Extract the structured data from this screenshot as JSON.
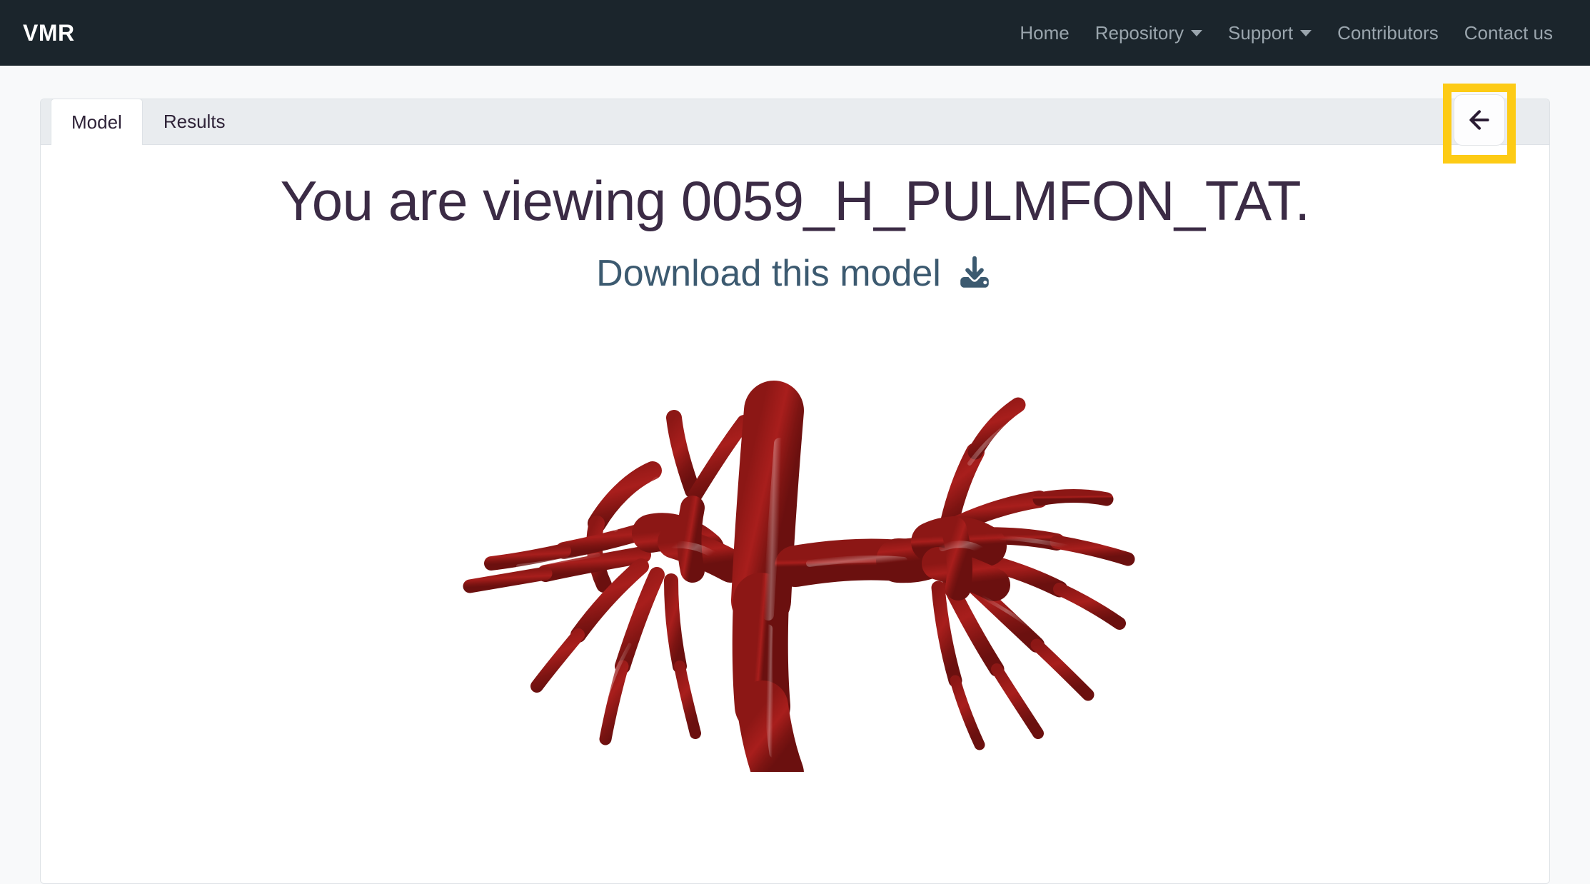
{
  "navbar": {
    "brand": "VMR",
    "items": [
      {
        "label": "Home",
        "has_caret": false
      },
      {
        "label": "Repository",
        "has_caret": true
      },
      {
        "label": "Support",
        "has_caret": true
      },
      {
        "label": "Contributors",
        "has_caret": false
      },
      {
        "label": "Contact us",
        "has_caret": false
      }
    ],
    "background_color": "#1b252c",
    "link_color": "#9aa5ad"
  },
  "tabs": [
    {
      "label": "Model",
      "active": true
    },
    {
      "label": "Results",
      "active": false
    }
  ],
  "back_button": {
    "icon": "arrow-left-icon",
    "highlight_color": "#fdcb15"
  },
  "main": {
    "title": "You are viewing 0059_H_PULMFON_TAT.",
    "download_label": "Download this model",
    "download_icon": "download-icon",
    "model_name": "0059_H_PULMFON_TAT",
    "model_color": "#9e1b18",
    "viewer_background": "#ffffff"
  }
}
